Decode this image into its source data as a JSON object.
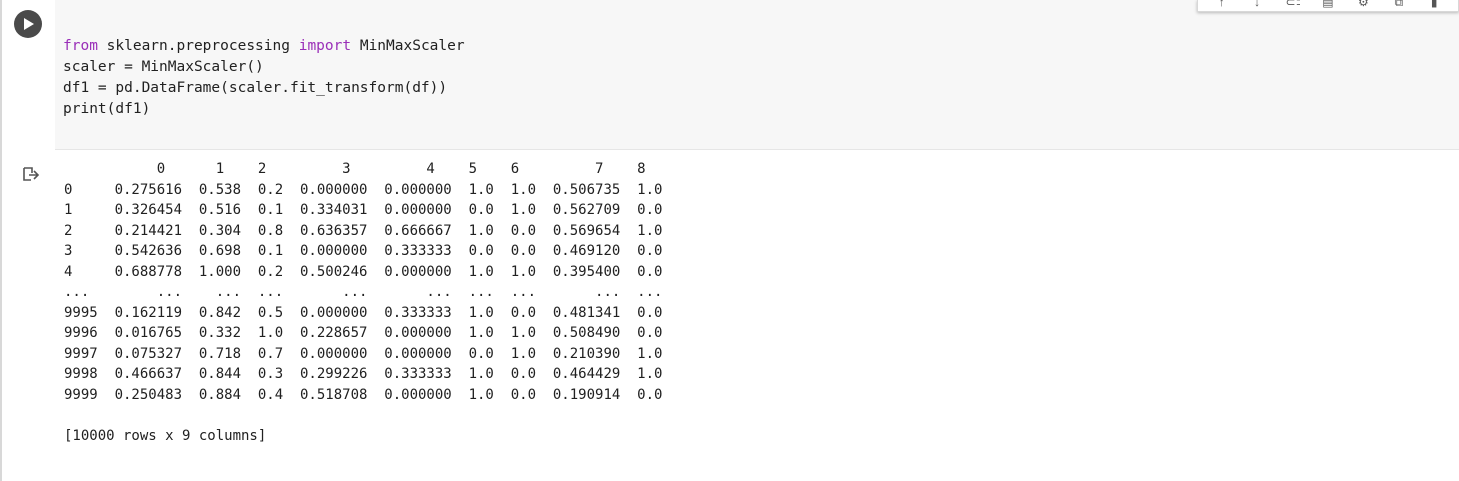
{
  "code_cell": {
    "lines": [
      {
        "kw1": "from",
        "mid": " sklearn.preprocessing ",
        "kw2": "import",
        "rest": " MinMaxScaler"
      },
      {
        "text": "scaler = MinMaxScaler()"
      },
      {
        "text": "df1 = pd.DataFrame(scaler.fit_transform(df))"
      },
      {
        "text": "print(df1)"
      }
    ]
  },
  "toolbar": {
    "icons": [
      "arrow-up-icon",
      "arrow-down-icon",
      "link-icon",
      "comment-icon",
      "settings-icon",
      "mirror-cell-icon",
      "delete-icon"
    ]
  },
  "output": {
    "header": "           0      1    2         3         4    5    6         7    8",
    "rows": [
      "0     0.275616  0.538  0.2  0.000000  0.000000  1.0  1.0  0.506735  1.0",
      "1     0.326454  0.516  0.1  0.334031  0.000000  0.0  1.0  0.562709  0.0",
      "2     0.214421  0.304  0.8  0.636357  0.666667  1.0  0.0  0.569654  1.0",
      "3     0.542636  0.698  0.1  0.000000  0.333333  0.0  0.0  0.469120  0.0",
      "4     0.688778  1.000  0.2  0.500246  0.000000  1.0  1.0  0.395400  0.0",
      "...        ...    ...  ...       ...       ...  ...  ...       ...  ...",
      "9995  0.162119  0.842  0.5  0.000000  0.333333  1.0  0.0  0.481341  0.0",
      "9996  0.016765  0.332  1.0  0.228657  0.000000  1.0  1.0  0.508490  0.0",
      "9997  0.075327  0.718  0.7  0.000000  0.000000  0.0  1.0  0.210390  1.0",
      "9998  0.466637  0.844  0.3  0.299226  0.333333  1.0  0.0  0.464429  1.0",
      "9999  0.250483  0.884  0.4  0.518708  0.000000  1.0  0.0  0.190914  0.0"
    ],
    "summary": "[10000 rows x 9 columns]"
  },
  "colors": {
    "keyword": "#9a2fb8",
    "code_background": "#f7f7f7",
    "run_button": "#4a4a4a"
  }
}
